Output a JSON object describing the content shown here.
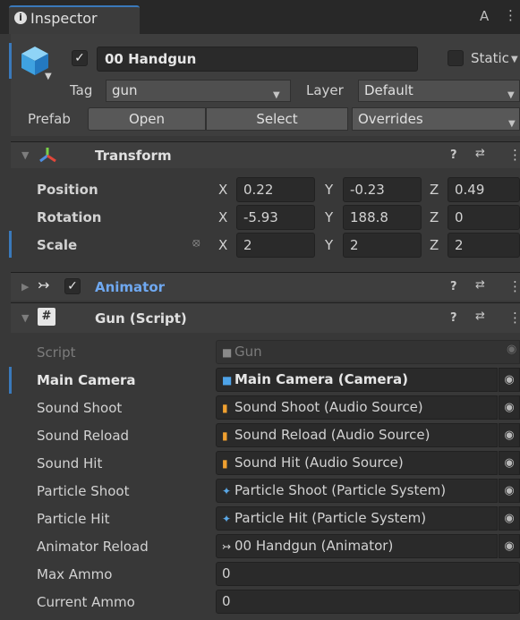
{
  "tab": {
    "icon": "info-icon",
    "title": "Inspector"
  },
  "gameobject": {
    "name": "00 Handgun",
    "active": true,
    "static_label": "Static",
    "tag_label": "Tag",
    "tag_value": "gun",
    "layer_label": "Layer",
    "layer_value": "Default"
  },
  "prefab": {
    "label": "Prefab",
    "open": "Open",
    "select": "Select",
    "overrides": "Overrides"
  },
  "transform": {
    "title": "Transform",
    "position_label": "Position",
    "rotation_label": "Rotation",
    "scale_label": "Scale",
    "position": {
      "x": "0.22",
      "y": "-0.23",
      "z": "0.49"
    },
    "rotation": {
      "x": "-5.93",
      "y": "188.8",
      "z": "0"
    },
    "scale": {
      "x": "2",
      "y": "2",
      "z": "2"
    },
    "axis_x": "X",
    "axis_y": "Y",
    "axis_z": "Z"
  },
  "animator": {
    "title": "Animator",
    "enabled": true
  },
  "gun_script": {
    "title": "Gun (Script)",
    "script_label": "Script",
    "script_value": "Gun",
    "fields": [
      {
        "label": "Main Camera",
        "value": "Main Camera (Camera)",
        "icon": "camera-icon",
        "icon_color": "#4ea3e8"
      },
      {
        "label": "Sound Shoot",
        "value": "Sound Shoot (Audio Source)",
        "icon": "audio-source-icon",
        "icon_color": "#f0a030"
      },
      {
        "label": "Sound Reload",
        "value": "Sound Reload (Audio Source)",
        "icon": "audio-source-icon",
        "icon_color": "#f0a030"
      },
      {
        "label": "Sound Hit",
        "value": "Sound Hit (Audio Source)",
        "icon": "audio-source-icon",
        "icon_color": "#f0a030"
      },
      {
        "label": "Particle Shoot",
        "value": "Particle Shoot (Particle System)",
        "icon": "particle-system-icon",
        "icon_color": "#5aa8e6"
      },
      {
        "label": "Particle Hit",
        "value": "Particle Hit (Particle System)",
        "icon": "particle-system-icon",
        "icon_color": "#5aa8e6"
      },
      {
        "label": "Animator Reload",
        "value": "00 Handgun (Animator)",
        "icon": "animator-icon",
        "icon_color": "#d2d2d2"
      }
    ],
    "max_ammo_label": "Max Ammo",
    "max_ammo": "0",
    "current_ammo_label": "Current Ammo",
    "current_ammo": "0"
  },
  "colors": {
    "background": "#383838",
    "header": "#3e3e3e",
    "field": "#2a2a2a",
    "animator_title": "#6fa8f0",
    "selection_bar": "#3a79bb"
  }
}
